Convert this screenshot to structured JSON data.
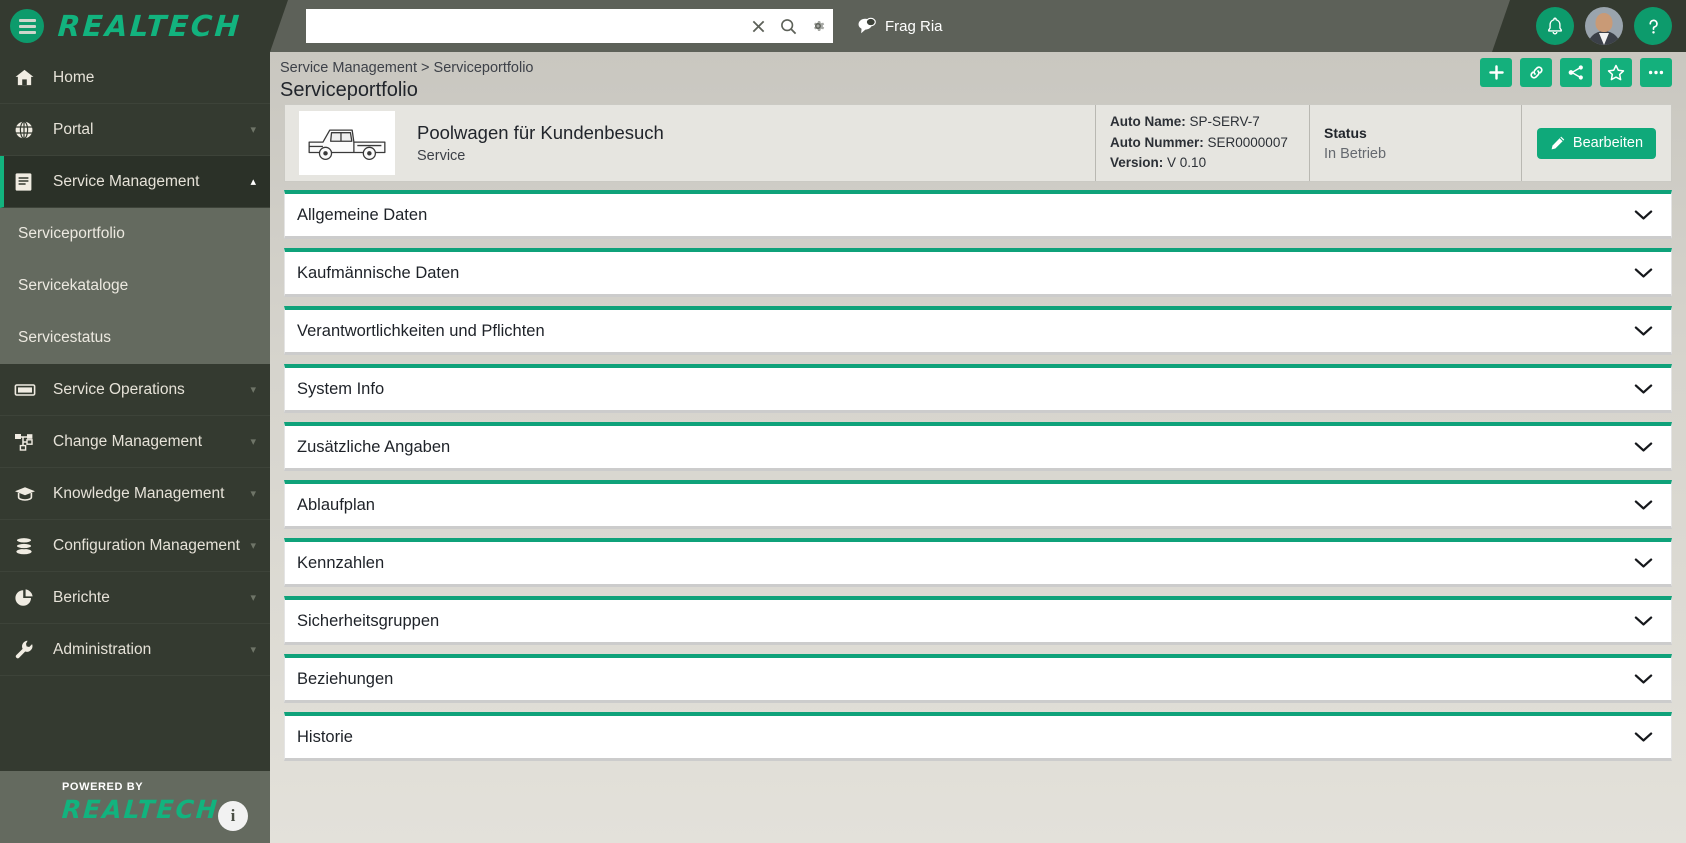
{
  "topbar": {
    "logo_text": "REALTECH",
    "menu_icon": "hamburger-icon",
    "search": {
      "value": "",
      "placeholder": ""
    },
    "search_clear_label": "×",
    "chat_label": "Frag Ria"
  },
  "sidebar": {
    "items": [
      {
        "label": "Home",
        "icon": "home-icon",
        "caret": "",
        "active": false
      },
      {
        "label": "Portal",
        "icon": "globe-icon",
        "caret": "▾",
        "active": false
      },
      {
        "label": "Service Management",
        "icon": "book-icon",
        "caret": "▴",
        "active": true
      },
      {
        "label": "Service Operations",
        "icon": "ticket-icon",
        "caret": "▾",
        "active": false
      },
      {
        "label": "Change Management",
        "icon": "org-chart-icon",
        "caret": "▾",
        "active": false
      },
      {
        "label": "Knowledge Management",
        "icon": "graduation-cap-icon",
        "caret": "▾",
        "active": false
      },
      {
        "label": "Configuration Management",
        "icon": "database-icon",
        "caret": "▾",
        "active": false
      },
      {
        "label": "Berichte",
        "icon": "pie-chart-icon",
        "caret": "▾",
        "active": false
      },
      {
        "label": "Administration",
        "icon": "wrench-icon",
        "caret": "▾",
        "active": false
      }
    ],
    "subitems": [
      {
        "label": "Serviceportfolio"
      },
      {
        "label": "Servicekataloge"
      },
      {
        "label": "Servicestatus"
      }
    ],
    "footer": {
      "powered_by": "POWERED BY",
      "logo_text": "REALTECH",
      "info_label": "i"
    }
  },
  "main": {
    "breadcrumb": "Service Management > Serviceportfolio",
    "page_title": "Serviceportfolio",
    "toolbar": [
      {
        "name": "add-button",
        "icon": "plus-icon"
      },
      {
        "name": "link-button",
        "icon": "link-icon"
      },
      {
        "name": "share-button",
        "icon": "share-nodes-icon"
      },
      {
        "name": "favorite-button",
        "icon": "star-icon"
      },
      {
        "name": "more-button",
        "icon": "ellipsis-icon"
      }
    ],
    "record": {
      "thumbnail_icon": "pickup-truck-image",
      "name": "Poolwagen für Kundenbesuch",
      "type": "Service",
      "meta": [
        {
          "label": "Auto Name:",
          "value": "SP-SERV-7"
        },
        {
          "label": "Auto Nummer:",
          "value": "SER0000007"
        },
        {
          "label": "Version:",
          "value": "V 0.10"
        }
      ],
      "status_label": "Status",
      "status_value": "In Betrieb",
      "edit_label": "Bearbeiten"
    },
    "sections": [
      {
        "label": "Allgemeine Daten",
        "expanded": false
      },
      {
        "label": "Kaufmännische Daten",
        "expanded": false
      },
      {
        "label": "Verantwortlichkeiten und Pflichten",
        "expanded": false
      },
      {
        "label": "System Info",
        "expanded": false
      },
      {
        "label": "Zusätzliche Angaben",
        "expanded": false
      },
      {
        "label": "Ablaufplan",
        "expanded": false
      },
      {
        "label": "Kennzahlen",
        "expanded": false
      },
      {
        "label": "Sicherheitsgruppen",
        "expanded": false
      },
      {
        "label": "Beziehungen",
        "expanded": false
      },
      {
        "label": "Historie",
        "expanded": false
      }
    ]
  },
  "colors": {
    "accent_green": "#0fa27a",
    "brand_green": "#12b37e",
    "topbar_dark": "#343a30",
    "topbar_gray": "#5d6159",
    "submenu_gray": "#646a5f"
  }
}
